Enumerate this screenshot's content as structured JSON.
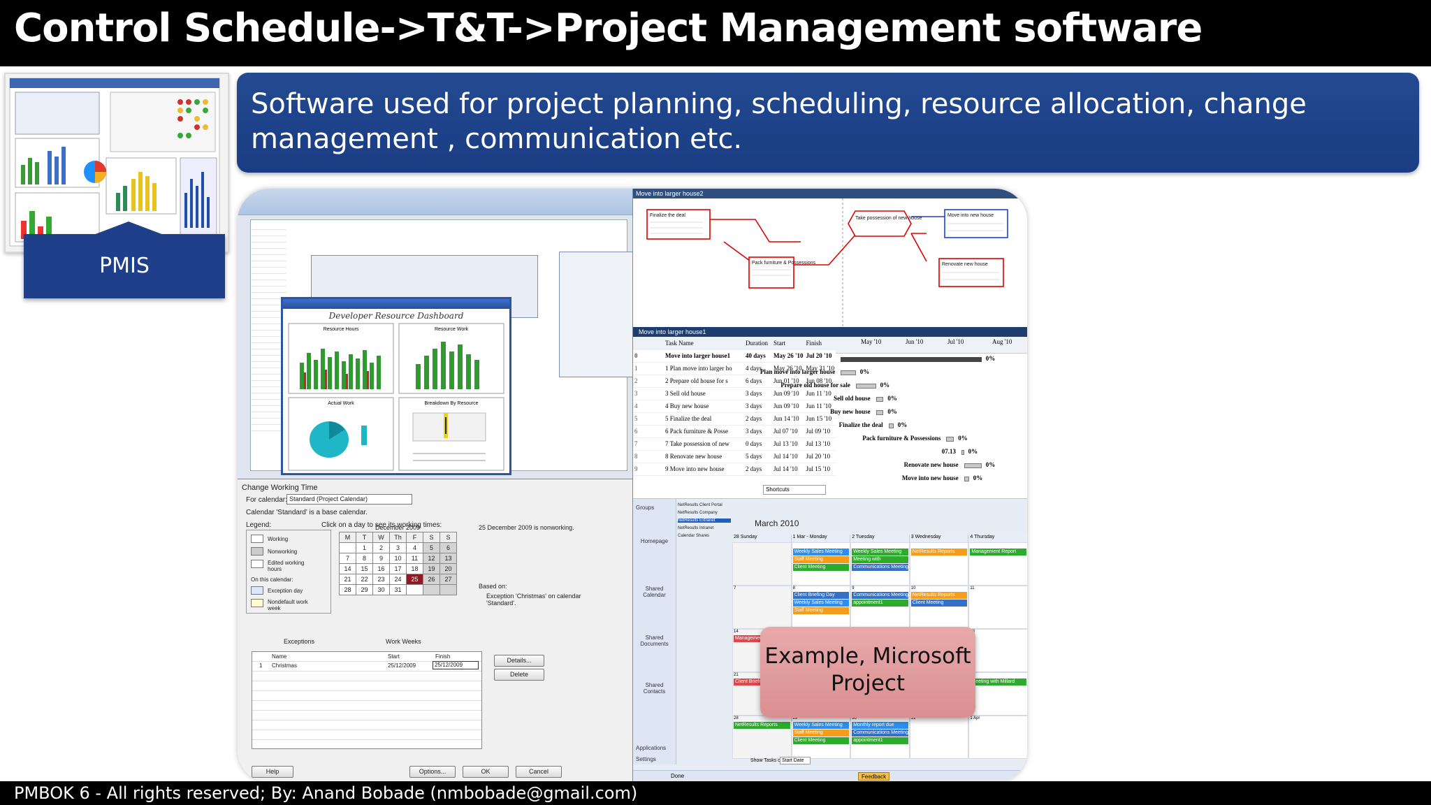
{
  "slide": {
    "title": "Control Schedule->T&T->Project Management software",
    "description": "Software used for project planning, scheduling, resource allocation, change management , communication etc.",
    "pmis_label": "PMIS",
    "callout": "Example, Microsoft Project",
    "footer": "PMBOK 6 - All rights reserved; By: Anand Bobade (nmbobade@gmail.com)"
  },
  "screenshots": {
    "dashboard": {
      "title": "Developer Resource Dashboard",
      "chart_titles": [
        "Resource Hours",
        "Resource Work",
        "Actual Work",
        "Breakdown By Resource"
      ]
    },
    "network": {
      "window_title": "Move into larger house2",
      "nodes": [
        "Finalize the deal",
        "Pack furniture & Possessions",
        "Take possession of new house",
        "Move into new house",
        "Renovate new house"
      ]
    },
    "gantt": {
      "window_title": "Move into larger house1",
      "columns": [
        "Task Name",
        "Duration",
        "Start",
        "Finish"
      ],
      "months": [
        "May '10",
        "Jun '10",
        "Jul '10",
        "Aug '10"
      ],
      "rows": [
        {
          "id": "0",
          "name": "Move into larger house1",
          "duration": "40 days",
          "start": "May 26 '10",
          "finish": "Jul 20 '10"
        },
        {
          "id": "1",
          "name": "1 Plan move into larger ho",
          "duration": "4 days",
          "start": "May 26 '10",
          "finish": "May 31 '10"
        },
        {
          "id": "2",
          "name": "2 Prepare old house for s",
          "duration": "6 days",
          "start": "Jun 01 '10",
          "finish": "Jun 08 '10"
        },
        {
          "id": "3",
          "name": "3 Sell old house",
          "duration": "3 days",
          "start": "Jun 09 '10",
          "finish": "Jun 11 '10"
        },
        {
          "id": "4",
          "name": "4 Buy new house",
          "duration": "3 days",
          "start": "Jun 09 '10",
          "finish": "Jun 11 '10"
        },
        {
          "id": "5",
          "name": "5 Finalize the deal",
          "duration": "2 days",
          "start": "Jun 14 '10",
          "finish": "Jun 15 '10"
        },
        {
          "id": "6",
          "name": "6 Pack furniture & Posse",
          "duration": "3 days",
          "start": "Jul 07 '10",
          "finish": "Jul 09 '10"
        },
        {
          "id": "7",
          "name": "7 Take possession of new",
          "duration": "0 days",
          "start": "Jul 13 '10",
          "finish": "Jul 13 '10"
        },
        {
          "id": "8",
          "name": "8 Renovate new house",
          "duration": "5 days",
          "start": "Jul 14 '10",
          "finish": "Jul 20 '10"
        },
        {
          "id": "9",
          "name": "9 Move into new house",
          "duration": "2 days",
          "start": "Jul 14 '10",
          "finish": "Jul 15 '10"
        }
      ],
      "bar_labels": [
        "Plan move into larger house",
        "Prepare old house for sale",
        "Sell old house",
        "Buy new house",
        "Finalize the deal",
        "Pack furniture & Possessions",
        "07.13",
        "Renovate new house",
        "Move into new house"
      ],
      "percent": "0%"
    },
    "change_working_time": {
      "title": "Change Working Time",
      "for_calendar_label": "For calendar:",
      "for_calendar_value": "Standard (Project Calendar)",
      "base_note": "Calendar 'Standard' is a base calendar.",
      "legend_label": "Legend:",
      "click_hint": "Click on a day to see its working times:",
      "legend_items": [
        "Working",
        "Nonworking",
        "Edited working hours",
        "Exception day",
        "Nondefault work week"
      ],
      "on_this_calendar": "On this calendar:",
      "month": "December 2009",
      "weekdays": [
        "M",
        "T",
        "W",
        "Th",
        "F",
        "S",
        "S"
      ],
      "weeks": [
        [
          "",
          "1",
          "2",
          "3",
          "4",
          "5",
          "6"
        ],
        [
          "7",
          "8",
          "9",
          "10",
          "11",
          "12",
          "13"
        ],
        [
          "14",
          "15",
          "16",
          "17",
          "18",
          "19",
          "20"
        ],
        [
          "21",
          "22",
          "23",
          "24",
          "25",
          "26",
          "27"
        ],
        [
          "28",
          "29",
          "30",
          "31",
          "",
          "",
          ""
        ]
      ],
      "status": "25 December 2009 is nonworking.",
      "based_on_label": "Based on:",
      "based_on_text": "Exception 'Christmas' on calendar 'Standard'.",
      "tabs": [
        "Exceptions",
        "Work Weeks"
      ],
      "exception_headers": [
        "Name",
        "Start",
        "Finish"
      ],
      "exception_row": {
        "id": "1",
        "name": "Christmas",
        "start": "25/12/2009",
        "finish": "25/12/2009"
      },
      "buttons": {
        "details": "Details...",
        "delete": "Delete",
        "help": "Help",
        "options": "Options...",
        "ok": "OK",
        "cancel": "Cancel"
      }
    },
    "outlook": {
      "month_title": "March 2010",
      "search": "Shortcuts",
      "nav_items": [
        "Groups",
        "Homepage",
        "Shared Calendar",
        "Shared Documents",
        "Shared Contacts",
        "Applications",
        "Settings"
      ],
      "calendars": [
        "NetResults Client Portal",
        "NetResults Company",
        "NetResults Extranet",
        "NetResults Intranet",
        "Calendar Shares"
      ],
      "day_headers": [
        "28 Sunday",
        "1 Mar - Monday",
        "2 Tuesday",
        "3 Wednesday",
        "4 Thursday"
      ],
      "week_numbers": [
        "7",
        "8",
        "9",
        "10",
        "11",
        "14",
        "15",
        "16",
        "17",
        "18",
        "21",
        "22",
        "23",
        "24",
        "25",
        "28",
        "29",
        "30",
        "31",
        "1 Apr"
      ],
      "events": [
        "Weekly Sales Meeting",
        "Prospective Client",
        "NetResults Reports",
        "Management Report",
        "Staff Meeting",
        "Meeting with",
        "Client Meeting",
        "Communications Meeting",
        "Client Briefing Day",
        "Taxes due",
        "Interview with Bob",
        "vnc meeting",
        "Meeting with Charles",
        "Meeting with Millard",
        "Monthly report due",
        "appointment1"
      ],
      "status": "Done",
      "feedback": "Feedback",
      "show_tasks": "Show Tasks on:",
      "start_date": "Start Date"
    }
  },
  "colors": {
    "title_bg": "#000000",
    "banner": "#1f3f8a",
    "callout": "#dc9a9c",
    "network_line": "#dd0000",
    "network_arrow": "#1f3fd8"
  }
}
